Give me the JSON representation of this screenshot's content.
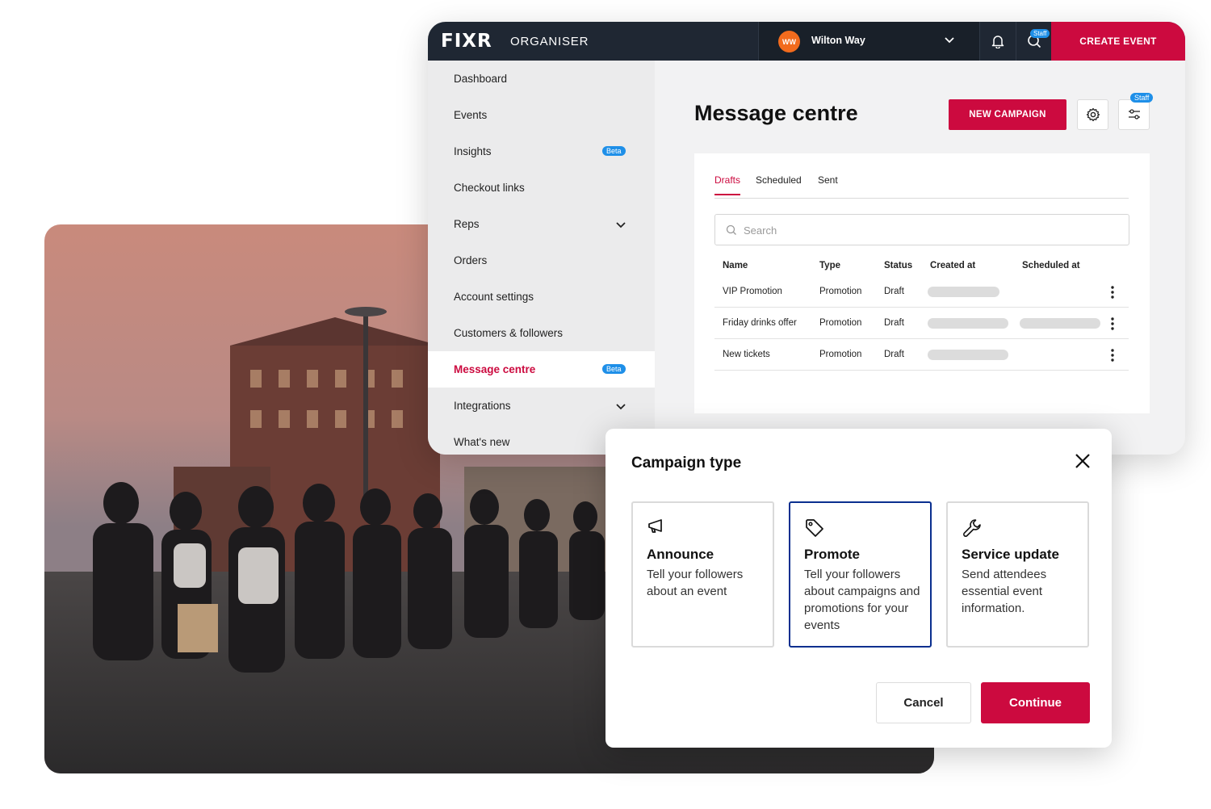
{
  "header": {
    "logo": "FIXR",
    "product": "ORGANISER",
    "account_initials": "WW",
    "account_name": "Wilton Way",
    "search_badge": "Staff",
    "create_event_label": "CREATE EVENT"
  },
  "sidebar": {
    "items": [
      {
        "label": "Dashboard"
      },
      {
        "label": "Events"
      },
      {
        "label": "Insights",
        "badge": "Beta"
      },
      {
        "label": "Checkout links"
      },
      {
        "label": "Reps",
        "expandable": true
      },
      {
        "label": "Orders"
      },
      {
        "label": "Account settings"
      },
      {
        "label": "Customers & followers"
      },
      {
        "label": "Message centre",
        "badge": "Beta",
        "active": true
      },
      {
        "label": "Integrations",
        "expandable": true
      },
      {
        "label": "What's new"
      }
    ]
  },
  "main": {
    "title": "Message centre",
    "new_campaign_label": "NEW CAMPAIGN",
    "filter_badge": "Staff",
    "tabs": [
      {
        "label": "Drafts",
        "selected": true
      },
      {
        "label": "Scheduled"
      },
      {
        "label": "Sent"
      }
    ],
    "search": {
      "placeholder": "Search",
      "value": ""
    },
    "table": {
      "columns": [
        "Name",
        "Type",
        "Status",
        "Created at",
        "Scheduled at"
      ],
      "rows": [
        {
          "name": "VIP Promotion",
          "type": "Promotion",
          "status": "Draft",
          "created_loading": true,
          "scheduled_loading": false
        },
        {
          "name": "Friday drinks offer",
          "type": "Promotion",
          "status": "Draft",
          "created_loading": true,
          "scheduled_loading": true
        },
        {
          "name": "New tickets",
          "type": "Promotion",
          "status": "Draft",
          "created_loading": true,
          "scheduled_loading": false
        }
      ]
    }
  },
  "dialog": {
    "title": "Campaign type",
    "options": [
      {
        "icon": "megaphone-icon",
        "title": "Announce",
        "description": "Tell your followers about an event"
      },
      {
        "icon": "tag-icon",
        "title": "Promote",
        "description": "Tell your followers about campaigns and promotions for your events",
        "selected": true
      },
      {
        "icon": "wrench-icon",
        "title": "Service update",
        "description": "Send attendees essential event information."
      }
    ],
    "cancel_label": "Cancel",
    "continue_label": "Continue"
  },
  "colors": {
    "brand_red": "#cc0a3f",
    "topbar": "#1f2733",
    "badge_blue": "#1e8fe8",
    "selected_border": "#0a2f8f"
  }
}
